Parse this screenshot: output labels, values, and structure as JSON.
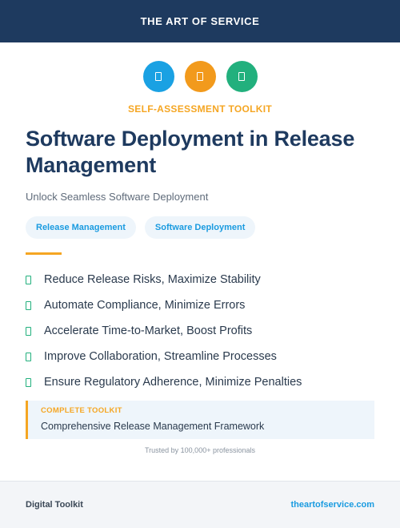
{
  "header": {
    "brand": "THE ART OF SERVICE"
  },
  "icons": [
    {
      "name": "document-icon",
      "color": "#1aa1e3"
    },
    {
      "name": "document-icon",
      "color": "#f29a1c"
    },
    {
      "name": "document-icon",
      "color": "#22b07d"
    }
  ],
  "kicker": "SELF-ASSESSMENT TOOLKIT",
  "title": "Software Deployment in Release Management",
  "subtitle": "Unlock Seamless Software Deployment",
  "tags": [
    "Release Management",
    "Software Deployment"
  ],
  "benefits": [
    "Reduce Release Risks, Maximize Stability",
    "Automate Compliance, Minimize Errors",
    "Accelerate Time-to-Market, Boost Profits",
    "Improve Collaboration, Streamline Processes",
    "Ensure Regulatory Adherence, Minimize Penalties"
  ],
  "callout": {
    "label": "COMPLETE TOOLKIT",
    "text": "Comprehensive Release Management Framework"
  },
  "trusted": "Trusted by 100,000+ professionals",
  "footer": {
    "left": "Digital Toolkit",
    "right": "theartofservice.com"
  },
  "colors": {
    "navy": "#1e3a5f",
    "accent_orange": "#f5a623",
    "accent_blue": "#1a9be0",
    "accent_green": "#22b07d"
  }
}
